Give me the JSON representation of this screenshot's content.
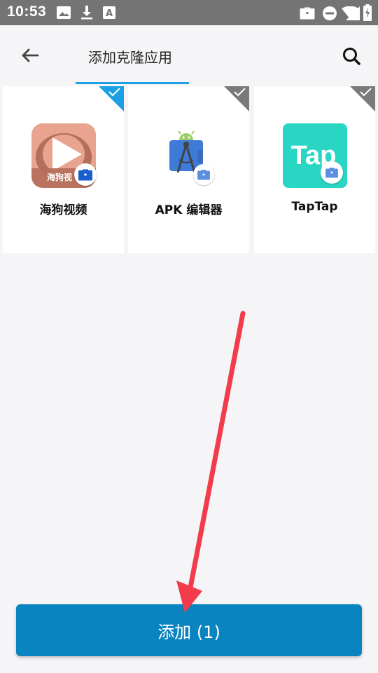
{
  "status_bar": {
    "time": "10:53",
    "left_icons": [
      "image-icon",
      "download-icon",
      "font-icon"
    ],
    "right_icons": [
      "briefcase-icon",
      "dnd-icon",
      "wifi-icon",
      "signal-icon",
      "battery-charging-icon"
    ]
  },
  "app_bar": {
    "title": "添加克隆应用",
    "back_icon": "arrow-back-icon",
    "search_icon": "search-icon",
    "accent_color": "#1ba0e6"
  },
  "apps": [
    {
      "name": "海狗视频",
      "selected": true,
      "icon_text": "海狗视"
    },
    {
      "name": "APK 编辑器",
      "selected": false
    },
    {
      "name": "TapTap",
      "selected": false,
      "icon_text": "Tap"
    }
  ],
  "add_button": {
    "label": "添加 (1)",
    "color": "#0a84c1"
  },
  "annotation": {
    "color": "#f23b4b"
  }
}
